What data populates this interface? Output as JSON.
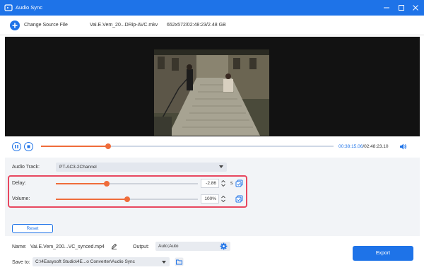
{
  "window": {
    "title": "Audio Sync",
    "accent_color": "#1e73e8"
  },
  "toolbar": {
    "change_source_label": "Change Source File",
    "file_name": "Vai.E.Vem_20...DRip-AVC.mkv",
    "file_info": "652x572/02:48:23/2.48 GB"
  },
  "player": {
    "current_time": "00:38:15.06",
    "total_time": "/02:48:23.10",
    "progress_fraction": 0.23
  },
  "settings": {
    "audio_track_label": "Audio Track:",
    "audio_track_value": "PT-AC3-2Channel",
    "delay_label": "Delay:",
    "delay_value": "-2.86",
    "delay_unit": "s",
    "delay_slider_fraction": 0.36,
    "volume_label": "Volume:",
    "volume_value": "100%",
    "volume_slider_fraction": 0.5,
    "reset_label": "Reset"
  },
  "output": {
    "name_label": "Name:",
    "name_value": "Vai.E.Vem_200...VC_synced.mp4",
    "output_label": "Output:",
    "output_value": "Auto;Auto",
    "save_label": "Save to:",
    "save_path": "C:\\4Easysoft Studio\\4E...o Converter\\Audio Sync",
    "export_label": "Export"
  },
  "colors": {
    "highlight": "#e8475f",
    "slider": "#ef6c3a"
  }
}
